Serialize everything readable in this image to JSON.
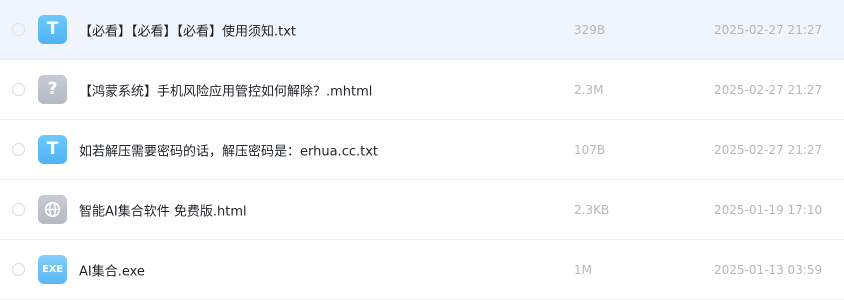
{
  "files": [
    {
      "icon": "txt-file-icon",
      "icon_glyph": "T",
      "name": "【必看】【必看】【必看】使用须知.txt",
      "size": "329B",
      "date": "2025-02-27 21:27"
    },
    {
      "icon": "unknown-file-icon",
      "icon_glyph": "?",
      "name": "【鸿蒙系统】手机风险应用管控如何解除？.mhtml",
      "size": "2.3M",
      "date": "2025-02-27 21:27"
    },
    {
      "icon": "txt-file-icon",
      "icon_glyph": "T",
      "name": "如若解压需要密码的话，解压密码是：erhua.cc.txt",
      "size": "107B",
      "date": "2025-02-27 21:27"
    },
    {
      "icon": "html-globe-icon",
      "icon_glyph": "",
      "name": "智能AI集合软件 免费版.html",
      "size": "2.3KB",
      "date": "2025-01-19 17:10"
    },
    {
      "icon": "exe-file-icon",
      "icon_glyph": "EXE",
      "name": "AI集合.exe",
      "size": "1M",
      "date": "2025-01-13 03:59"
    }
  ]
}
